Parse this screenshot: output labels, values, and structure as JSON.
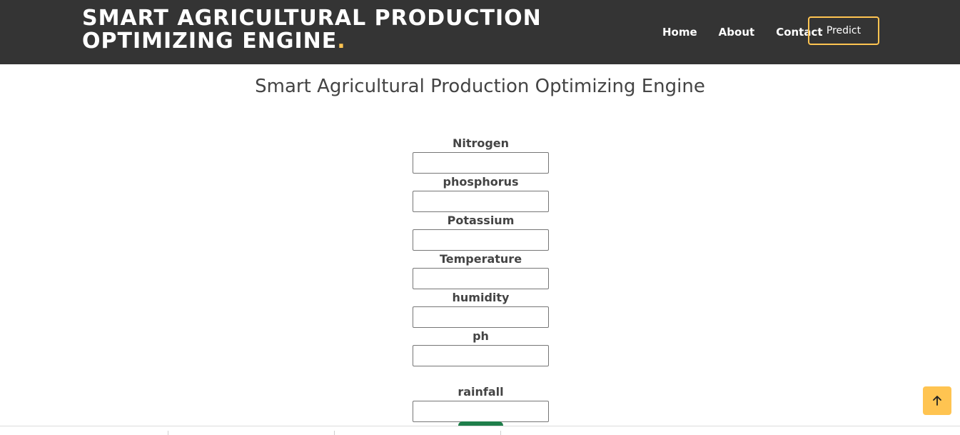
{
  "header": {
    "brand_line1": "SMART AGRICULTURAL PRODUCTION",
    "brand_line2": "OPTIMIZING ENGINE",
    "brand_dot": ".",
    "nav": {
      "home": "Home",
      "about": "About",
      "contact": "Contact"
    },
    "predict_label": "Predict"
  },
  "main": {
    "title": "Smart Agricultural Production Optimizing Engine",
    "fields": [
      {
        "label": "Nitrogen",
        "value": ""
      },
      {
        "label": "phosphorus",
        "value": ""
      },
      {
        "label": "Potassium",
        "value": ""
      },
      {
        "label": "Temperature",
        "value": ""
      },
      {
        "label": "humidity",
        "value": ""
      },
      {
        "label": "ph",
        "value": ""
      },
      {
        "label": "rainfall",
        "value": ""
      }
    ]
  },
  "colors": {
    "header_bg": "#343434",
    "accent": "#ffc451",
    "submit": "#1e7e4a"
  },
  "icons": {
    "scroll_top": "arrow-up-icon"
  }
}
